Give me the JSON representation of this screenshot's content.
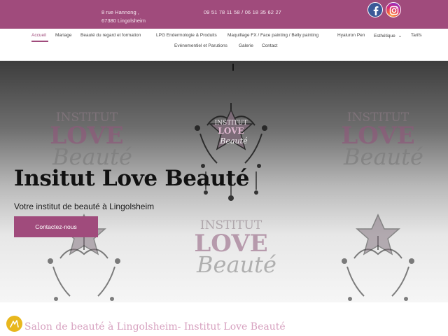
{
  "topbar": {
    "address_line1": "8 rue Hannong ,",
    "address_line2": "67380 Lingolsheim",
    "phones": "09 51 78 11 58 /  06 18 35 62 27",
    "social_icons": [
      "facebook-icon",
      "instagram-icon"
    ]
  },
  "nav": {
    "row1": [
      "Accueil",
      "Mariage",
      "Beauté du regard et formation",
      "LPG Endermologie & Produits",
      "Maquillage FX / Face painting / Belly painting",
      "Hyaluron Pen",
      "Esthétique",
      "Tarifs"
    ],
    "row2": [
      "Evénementiel et Parutions",
      "Galerie",
      "Contact"
    ],
    "active": "Accueil"
  },
  "hero": {
    "logo_text": [
      "INSTITUT",
      "LOVE",
      "Beauté"
    ],
    "title": "Insitut Love Beauté",
    "subtitle": "Votre institut de beauté à Lingolsheim",
    "cta": "Contactez-nous"
  },
  "section": {
    "title": "Salon de beauté à Lingolsheim- Institut Love Beauté"
  },
  "colors": {
    "brand": "#a04b7c",
    "accent_gold": "#e8b71d",
    "section_title": "#d7a2c0"
  }
}
